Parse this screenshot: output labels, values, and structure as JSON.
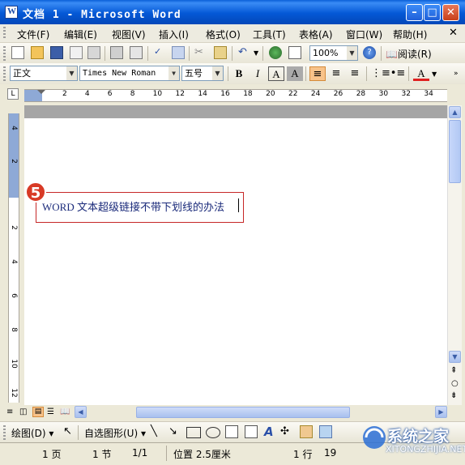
{
  "window": {
    "title": "文档 1 - Microsoft Word"
  },
  "menu": [
    "文件(F)",
    "编辑(E)",
    "视图(V)",
    "插入(I)",
    "格式(O)",
    "工具(T)",
    "表格(A)",
    "窗口(W)",
    "帮助(H)"
  ],
  "toolbar": {
    "zoom": "100%",
    "read_label": "阅读(R)"
  },
  "format": {
    "style": "正文",
    "font": "Times New Roman",
    "size": "五号",
    "bold": "B",
    "italic": "I",
    "font_color_glyph": "A"
  },
  "ruler": {
    "numbers": [
      "2",
      "4",
      "6",
      "8",
      "10",
      "12",
      "14",
      "16",
      "18",
      "20",
      "22",
      "24",
      "26",
      "28",
      "30",
      "32",
      "34"
    ]
  },
  "vruler": {
    "numbers": [
      "4",
      "2",
      "2",
      "4",
      "6",
      "8",
      "10",
      "12"
    ]
  },
  "document": {
    "text": "WORD 文本超级链接不带下划线的办法",
    "step_number": "5"
  },
  "drawing": {
    "draw_label": "绘图(D)",
    "autoshapes_label": "自选图形(U)"
  },
  "status": {
    "page": "1 页",
    "section": "1 节",
    "page_of": "1/1",
    "position": "位置 2.5厘米",
    "line": "1 行",
    "col": "19"
  },
  "watermark": {
    "brand": "系统之家",
    "url": "XITONGZHIJIA.NET"
  },
  "colors": {
    "titlebar": "#0458D6",
    "accent_red": "#d83a26",
    "font_color": "#e02020"
  }
}
